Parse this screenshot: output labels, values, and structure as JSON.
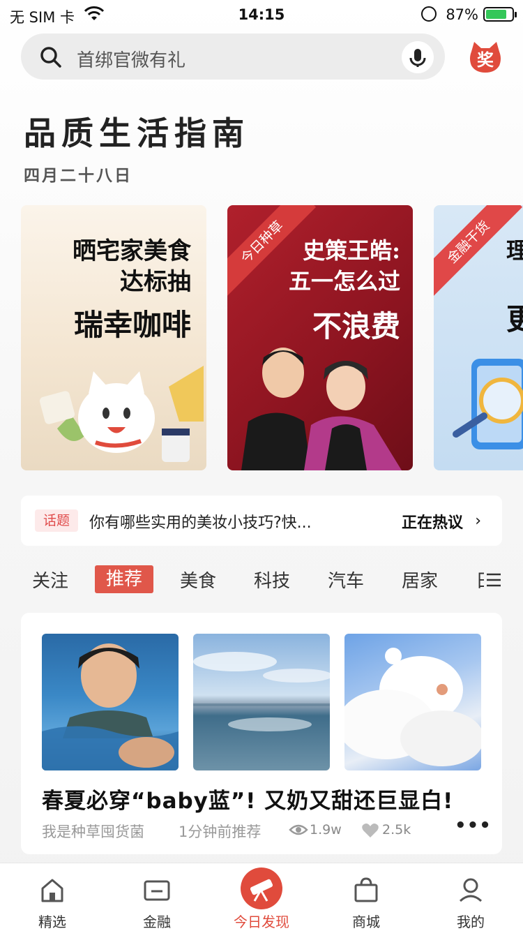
{
  "status_bar": {
    "carrier": "无 SIM 卡",
    "time": "14:15",
    "battery": "87%"
  },
  "search": {
    "placeholder": "首绑官微有礼"
  },
  "prize_badge": "奖",
  "header": {
    "title": "品质生活指南",
    "date": "四月二十八日"
  },
  "cards": [
    {
      "lines": [
        "晒宅家美食",
        "达标抽",
        "瑞幸咖啡"
      ],
      "ribbon": ""
    },
    {
      "lines": [
        "史策王皓:",
        "五一怎么过",
        "不浪费"
      ],
      "ribbon": "今日种草"
    },
    {
      "lines": [
        "理",
        "更"
      ],
      "ribbon": "金融干货"
    }
  ],
  "topic": {
    "tag": "话题",
    "text": "你有哪些实用的美妆小技巧?快...",
    "hot": "正在热议"
  },
  "tabs": [
    "关注",
    "推荐",
    "美食",
    "科技",
    "汽车",
    "居家",
    "日"
  ],
  "active_tab": "推荐",
  "feed": {
    "title": "春夏必穿“baby蓝”! 又奶又甜还巨显白!",
    "author": "我是种草囤货菌",
    "time": "1分钟前推荐",
    "views": "1.9w",
    "likes": "2.5k"
  },
  "bottom_nav": [
    {
      "label": "精选",
      "icon": "home-icon"
    },
    {
      "label": "金融",
      "icon": "card-icon"
    },
    {
      "label": "今日发现",
      "icon": "telescope-icon"
    },
    {
      "label": "商城",
      "icon": "bag-icon"
    },
    {
      "label": "我的",
      "icon": "user-icon"
    }
  ],
  "colors": {
    "accent": "#e04b3c",
    "tag_bg": "#fdeaea"
  }
}
